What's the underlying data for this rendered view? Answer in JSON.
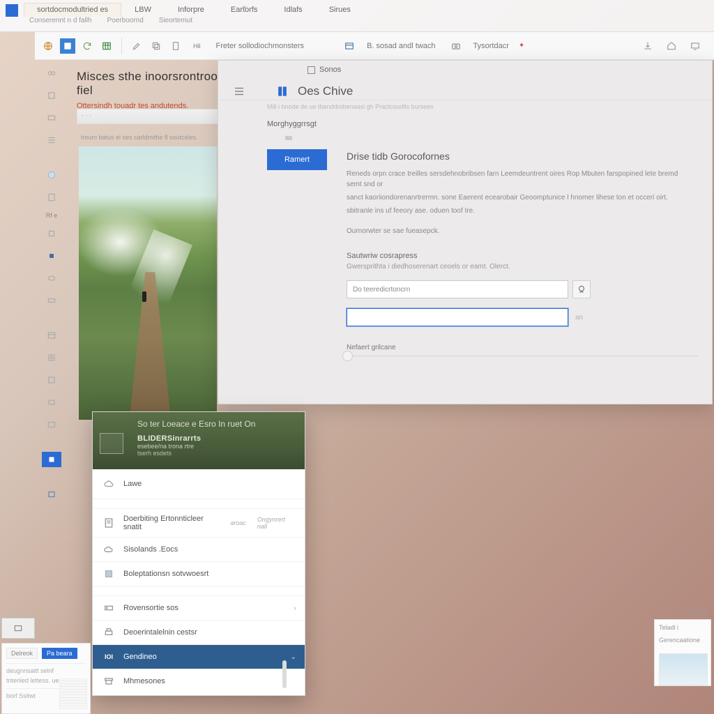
{
  "menubar": {
    "tabs": [
      "sortdocmodultried es",
      "LBW",
      "Inforpre",
      "Eartorfs",
      "Idlafs",
      "Sirues"
    ],
    "subtabs": [
      "Conserennt n d fallh",
      "Poerboornd",
      "Sieortemut"
    ],
    "close": "×"
  },
  "ribbon": {
    "label_center": "Freter sollodiochmonsters",
    "group_b_label": "B. sosad andl twach",
    "group_c_label": "Tysortdacr"
  },
  "doc": {
    "title": "Misces sthe inoorsrontrood fiel",
    "subtitle": "Ottersindh touadr tes andutends.",
    "toolbar_text": "· · ·",
    "caption": "treum batus el ses carldmithe fl soutceles."
  },
  "icon_rail": {
    "label": "Rf e"
  },
  "settings": {
    "top_label": "Sonos",
    "title": "Oes Chive",
    "breadcrumb_tiny": "Mill i bnode de ue tbenddrobenaasi gh Practcoudlls bursees",
    "tab": "Morghyggrrsgt",
    "button": "Ramert",
    "h3": "Drise tidb Gorocofornes",
    "p1": "Reneds orpn crace treilles sersdehnobribsen farn Leemdeuntrent oires Rop Mbuten farspopined lete bremd semt snd or",
    "p2": "sanct kaoriiondorenanrtrermn. sone Eaerent ecearobair Geoomptunice l hnomer lihese ton et occeri oirt.",
    "p3": "sbitranle ins uf feeory ase. oduen toof Ire.",
    "note": "Ournorwter se sae fueasepck.",
    "section_label": "Sautwriw cosrapress",
    "section_desc": "Gwersprithta i diedhoserenart ceoels or eamt. Olerct.",
    "field1_value": "Do teeredicrtoncrn",
    "field2_value": "",
    "field2_trail": "an",
    "divider_label": "Nefaert grilcane"
  },
  "popup": {
    "title": "So ter Loeace e Esro In ruet On",
    "big": "BLIDERSinrarrts",
    "sub": "esebee/na trona rtre",
    "sub2": "tserh esdets",
    "first_row": "Lawe",
    "items": [
      {
        "label": "Doerbiting Ertonnticleer snatit",
        "meta": "aroac",
        "meta2": "Ongynrert nall"
      },
      {
        "label": "Sisolands .Eocs"
      },
      {
        "label": "Boleptationsn sotvwoesrt"
      },
      {
        "label": "Rovensortie sos",
        "arrow": "›"
      },
      {
        "label": "Deoerintalelnin cestsr"
      },
      {
        "label": "Gendineo",
        "selected": true,
        "prefix": "IOI"
      },
      {
        "label": "Mhmesones"
      }
    ]
  },
  "mini_b": {
    "tab_a": "Delreok",
    "tab_b": "Pa beara",
    "row1": "deugnnsaitt selnf",
    "row2": "tnteriied lettess. ue",
    "row3": "borf  Ssitwt"
  },
  "mini_c": {
    "label_top": "Teladl i",
    "label_mid": "Gerencaatione"
  },
  "chip_right": "S Asf  Or"
}
